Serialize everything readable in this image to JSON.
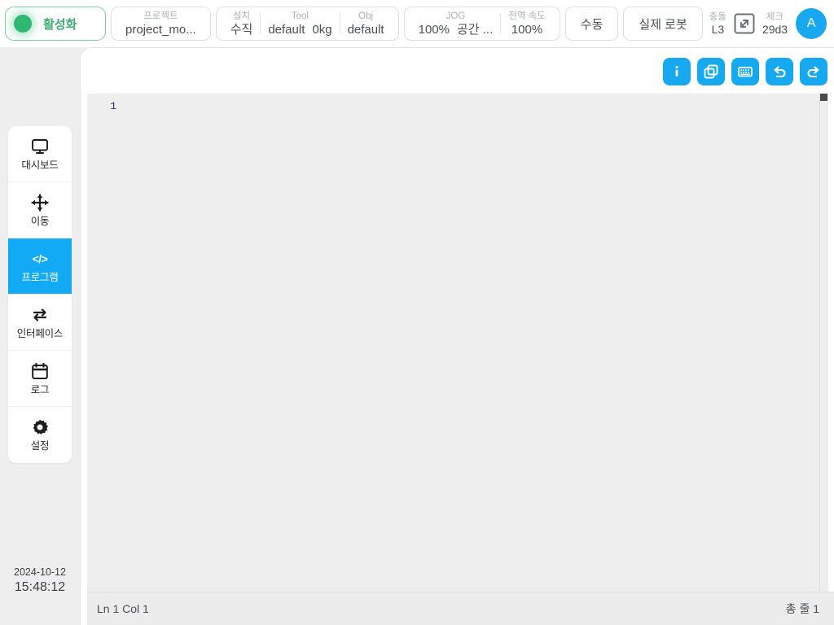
{
  "topbar": {
    "activation": {
      "label": "활성화",
      "indicator": "status-led-green",
      "color": "#3cae75"
    },
    "project": {
      "key": "프로젝트",
      "value": "project_mo..."
    },
    "install": {
      "key": "설치",
      "value": "수직"
    },
    "tool": {
      "key": "Tool",
      "value": "default",
      "payload": "0kg"
    },
    "obj": {
      "key": "Obj",
      "value": "default"
    },
    "jog": {
      "key": "JOG",
      "value": "100%",
      "mode": "공간 ..."
    },
    "global_speed": {
      "key": "전역 속도",
      "value": "100%"
    },
    "mode_button": "수동",
    "robot_button": "실제 로봇",
    "collision": {
      "key": "충돌",
      "value": "L3"
    },
    "expand_icon": "expand-arrows-icon",
    "check": {
      "key": "체크",
      "value": "29d3"
    },
    "avatar": {
      "initial": "A",
      "color": "#18a8ef"
    }
  },
  "sidebar": {
    "items": [
      {
        "label": "대시보드",
        "icon": "monitor-icon",
        "active": false
      },
      {
        "label": "이동",
        "icon": "move-arrows-icon",
        "active": false
      },
      {
        "label": "프로그램",
        "icon": "code-brackets-icon",
        "active": true
      },
      {
        "label": "인터페이스",
        "icon": "exchange-arrows-icon",
        "active": false
      },
      {
        "label": "로그",
        "icon": "calendar-icon",
        "active": false
      },
      {
        "label": "설정",
        "icon": "gear-icon",
        "active": false
      }
    ],
    "active_color": "#12a9f5"
  },
  "clock": {
    "date": "2024-10-12",
    "time": "15:48:12"
  },
  "toolbar": {
    "buttons": [
      {
        "name": "info",
        "icon": "info-icon",
        "label": "i"
      },
      {
        "name": "duplicate",
        "icon": "copy-icon",
        "label": ""
      },
      {
        "name": "keyboard",
        "icon": "keyboard-icon",
        "label": ""
      },
      {
        "name": "undo",
        "icon": "undo-arrow-icon",
        "label": ""
      },
      {
        "name": "redo",
        "icon": "redo-arrow-icon",
        "label": ""
      }
    ],
    "color": "#16a9f0"
  },
  "editor": {
    "line_numbers": [
      "1"
    ],
    "content": "",
    "background": "#eeeeee"
  },
  "statusbar": {
    "cursor": "Ln 1 Col 1",
    "total_lines": "총 줄 1"
  }
}
